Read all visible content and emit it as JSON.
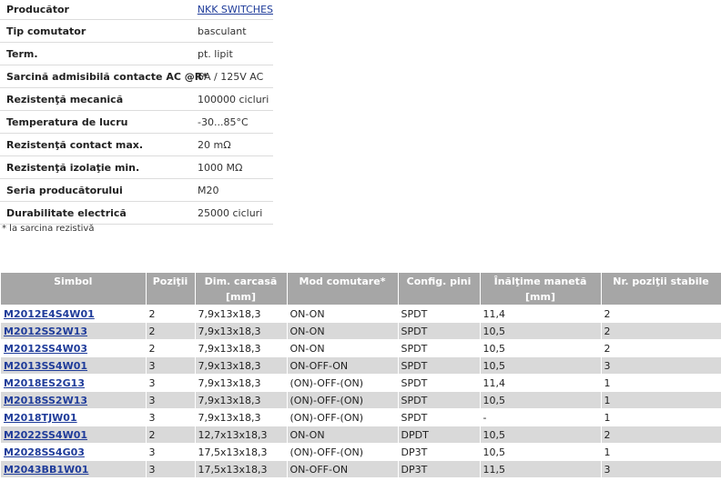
{
  "specs": [
    {
      "label": "Producător",
      "value": "NKK SWITCHES",
      "link": true
    },
    {
      "label": "Tip comutator",
      "value": "basculant"
    },
    {
      "label": "Term.",
      "value": "pt. lipit"
    },
    {
      "label": "Sarcină admisibilă contacte AC @R*",
      "value": "6A / 125V AC"
    },
    {
      "label": "Rezistenţă mecanică",
      "value": "100000 cicluri"
    },
    {
      "label": "Temperatura de lucru",
      "value": "-30...85°C"
    },
    {
      "label": "Rezistenţă contact max.",
      "value": "20 mΩ"
    },
    {
      "label": "Rezistenţă izolaţie min.",
      "value": "1000 MΩ"
    },
    {
      "label": "Seria producătorului",
      "value": "M20"
    },
    {
      "label": "Durabilitate electrică",
      "value": "25000 cicluri"
    }
  ],
  "footnote": "* la sarcina rezistivă",
  "table": {
    "headers": [
      "Simbol",
      "Poziţii",
      "Dim. carcasă",
      "Mod comutare*",
      "Config. pini",
      "Înălţime manetă",
      "Nr. poziţii stabile"
    ],
    "units": [
      "",
      "",
      "[mm]",
      "",
      "",
      "[mm]",
      ""
    ],
    "rows": [
      [
        "M2012E4S4W01",
        "2",
        "7,9x13x18,3",
        "ON-ON",
        "SPDT",
        "11,4",
        "2"
      ],
      [
        "M2012SS2W13",
        "2",
        "7,9x13x18,3",
        "ON-ON",
        "SPDT",
        "10,5",
        "2"
      ],
      [
        "M2012SS4W03",
        "2",
        "7,9x13x18,3",
        "ON-ON",
        "SPDT",
        "10,5",
        "2"
      ],
      [
        "M2013SS4W01",
        "3",
        "7,9x13x18,3",
        "ON-OFF-ON",
        "SPDT",
        "10,5",
        "3"
      ],
      [
        "M2018ES2G13",
        "3",
        "7,9x13x18,3",
        "(ON)-OFF-(ON)",
        "SPDT",
        "11,4",
        "1"
      ],
      [
        "M2018SS2W13",
        "3",
        "7,9x13x18,3",
        "(ON)-OFF-(ON)",
        "SPDT",
        "10,5",
        "1"
      ],
      [
        "M2018TJW01",
        "3",
        "7,9x13x18,3",
        "(ON)-OFF-(ON)",
        "SPDT",
        "-",
        "1"
      ],
      [
        "M2022SS4W01",
        "2",
        "12,7x13x18,3",
        "ON-ON",
        "DPDT",
        "10,5",
        "2"
      ],
      [
        "M2028SS4G03",
        "3",
        "17,5x13x18,3",
        "(ON)-OFF-(ON)",
        "DP3T",
        "10,5",
        "1"
      ],
      [
        "M2043BB1W01",
        "3",
        "17,5x13x18,3",
        "ON-OFF-ON",
        "DP3T",
        "11,5",
        "3"
      ]
    ]
  }
}
